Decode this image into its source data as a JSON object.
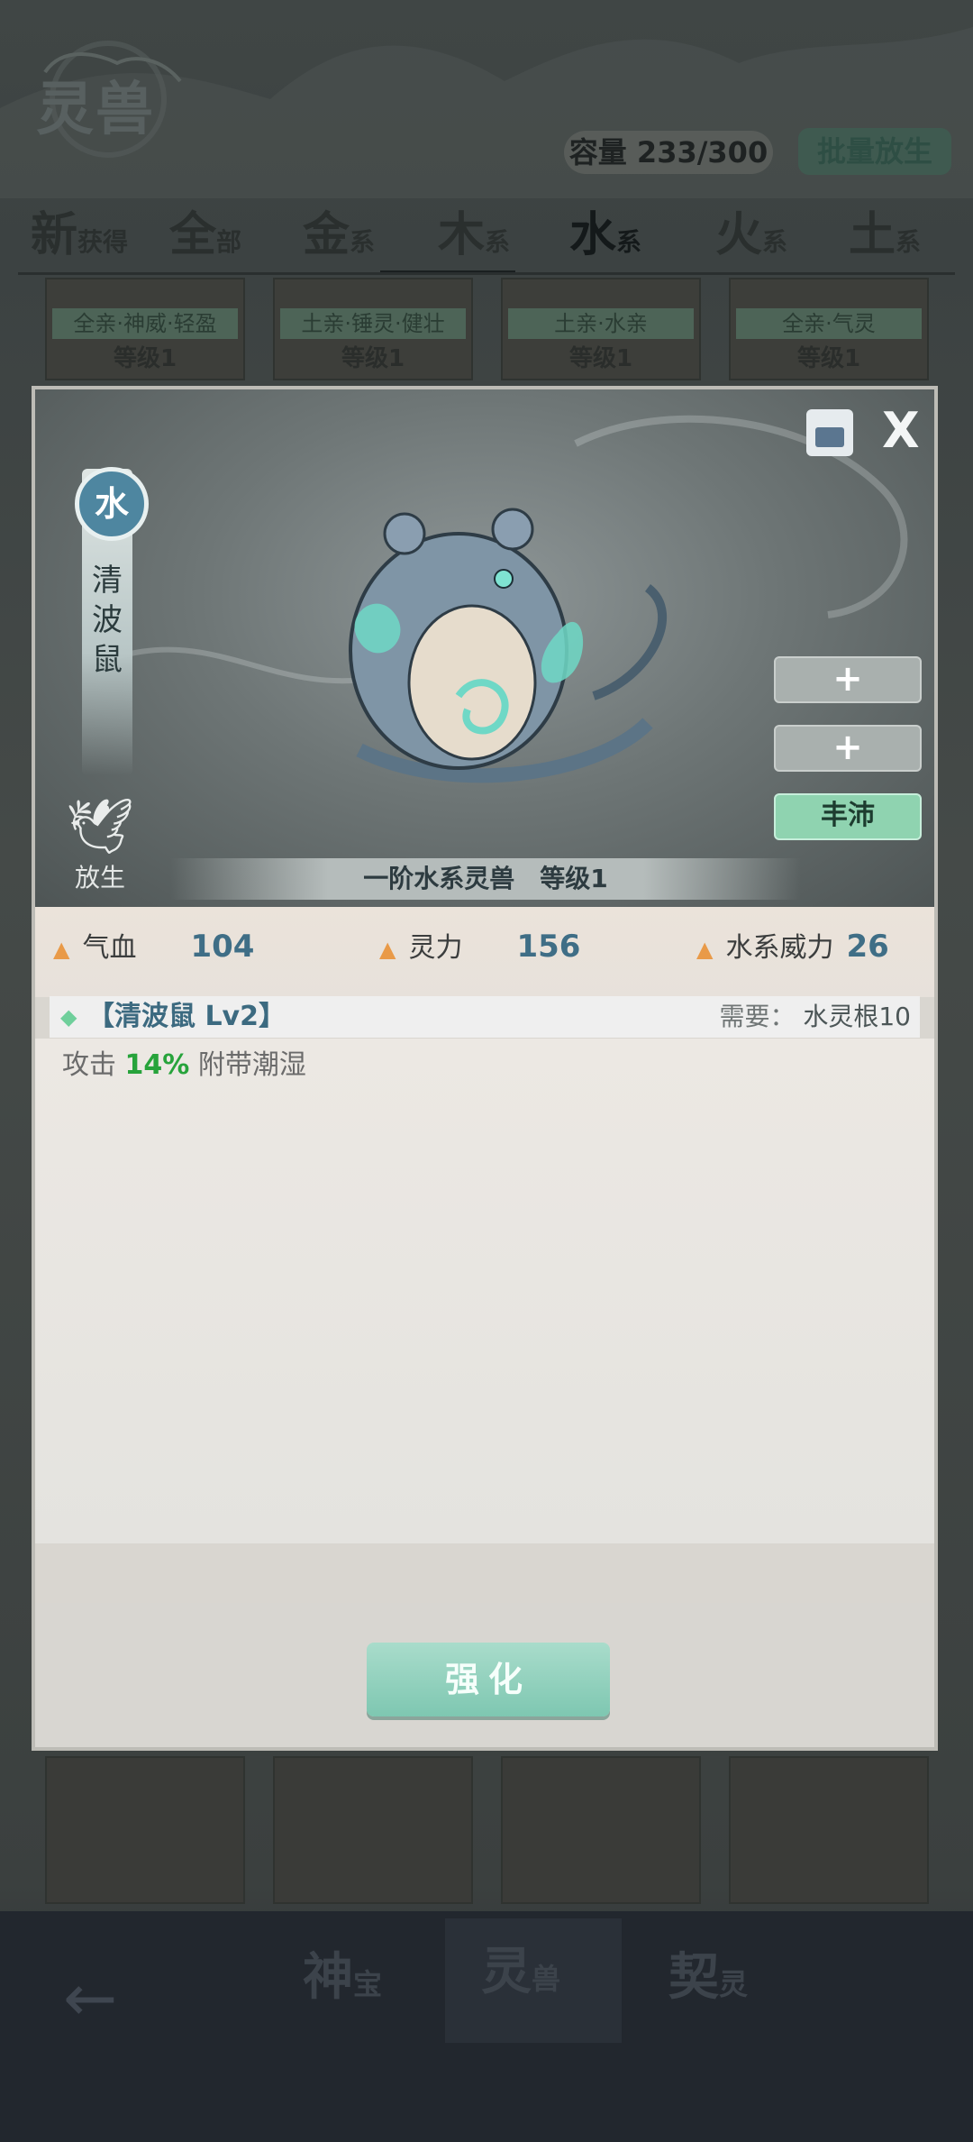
{
  "header": {
    "logo_text": "灵兽",
    "capacity_label": "容量 233/300",
    "release_all_label": "批量放生"
  },
  "tabs": [
    {
      "big": "新",
      "small": "获得"
    },
    {
      "big": "全",
      "small": "部"
    },
    {
      "big": "金",
      "small": "系"
    },
    {
      "big": "木",
      "small": "系"
    },
    {
      "big": "水",
      "small": "系",
      "active": true
    },
    {
      "big": "火",
      "small": "系"
    },
    {
      "big": "土",
      "small": "系"
    }
  ],
  "top_cards": [
    {
      "trait": "全亲·神威·轻盈",
      "level": "等级1"
    },
    {
      "trait": "土亲·锤灵·健壮",
      "level": "等级1"
    },
    {
      "trait": "土亲·水亲",
      "level": "等级1"
    },
    {
      "trait": "全亲·气灵",
      "level": "等级1"
    }
  ],
  "dialog": {
    "element": "水",
    "name_vertical": [
      "清",
      "波",
      "鼠"
    ],
    "release_label": "放生",
    "side_buttons": [
      "+",
      "+",
      "丰沛"
    ],
    "caption": "一阶水系灵兽　等级1",
    "close_label": "X",
    "stats": [
      {
        "label": "气血",
        "value": "104"
      },
      {
        "label": "灵力",
        "value": "156"
      },
      {
        "label": "水系威力",
        "value": "26"
      }
    ],
    "skill": {
      "name": "【清波鼠 Lv2】",
      "req_label": "需要：",
      "req_value": "水灵根10",
      "desc_prefix": "攻击",
      "desc_pct": "14%",
      "desc_suffix": "附带潮湿"
    },
    "strengthen_label": "强化"
  },
  "bottom_nav": {
    "back_icon": "←",
    "tabs": [
      {
        "big": "神",
        "small": "宝"
      },
      {
        "big": "灵",
        "small": "兽",
        "active": true
      },
      {
        "big": "契",
        "small": "灵"
      }
    ]
  },
  "colors": {
    "accent_green": "#8fd3b0",
    "water_blue": "#4e86a0",
    "stat_value": "#3f6e86",
    "percent_green": "#27a33b"
  }
}
